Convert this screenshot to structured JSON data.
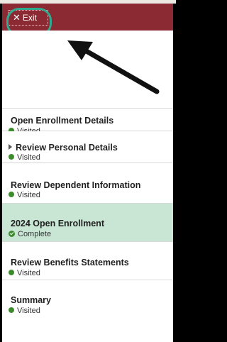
{
  "header": {
    "exit_label": "Exit",
    "exit_icon": "close-icon",
    "brand_color": "#8c2a33",
    "highlight_color": "#2faa8e"
  },
  "steps": [
    {
      "title": "Open Enrollment Details",
      "status": "Visited",
      "expandable": false,
      "active": false
    },
    {
      "title": "Review Personal Details",
      "status": "Visited",
      "expandable": true,
      "active": false
    },
    {
      "title": "Review Dependent Information",
      "status": "Visited",
      "expandable": false,
      "active": false
    },
    {
      "title": "2024 Open Enrollment",
      "status": "Complete",
      "expandable": false,
      "active": true
    },
    {
      "title": "Review Benefits Statements",
      "status": "Visited",
      "expandable": false,
      "active": false
    },
    {
      "title": "Summary",
      "status": "Visited",
      "expandable": false,
      "active": false
    }
  ],
  "colors": {
    "active_bg": "#c9e6d5",
    "status_dot": "#3c8c2e"
  }
}
